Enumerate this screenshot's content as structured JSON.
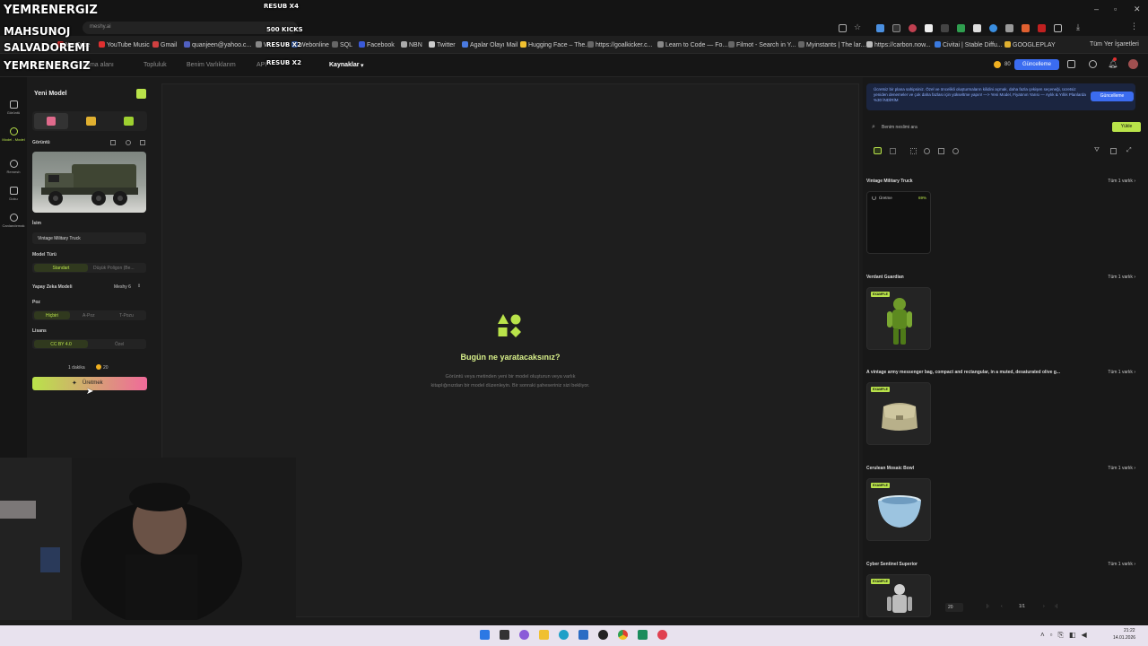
{
  "overlay": {
    "streamer1": "YEMRENERGIZ",
    "streamer2": "MAHSUNOJ",
    "streamer3": "SALVADOREMI",
    "streamer4": "YEMRENERGIZ",
    "resub1": "RESUB X4",
    "kicks": "500 KICKS",
    "resub2": "RESUB X2",
    "resub3": "RESUB X2"
  },
  "browser": {
    "url": "meshy.ai",
    "bookmarks": [
      "YouTube",
      "YouTube Music",
      "Gmail",
      "quanjeen@yahoo.c...",
      "W...",
      "Webonline",
      "SQL",
      "Facebook",
      "NBN",
      "Twitter",
      "Agalar Olayı Mail",
      "Hugging Face – The...",
      "https://goalkicker.c...",
      "Learn to Code — Fo...",
      "Filmot - Search in Y...",
      "Myinstants | The lar...",
      "https://carbon.now...",
      "Civitai | Stable Diffu...",
      "GOOGLEPLAY"
    ],
    "all_bookmarks": "Tüm Yer İşaretleri"
  },
  "appnav": {
    "items": [
      "Çalışma alanı",
      "Topluluk",
      "Benim Varlıklarım",
      "API",
      "Kaynaklar"
    ],
    "credits": "80",
    "upgrade": "Güncelleme"
  },
  "rail": {
    "items": [
      "Görüntü",
      "Model - Model",
      "Remesh",
      "Doku",
      "Canlandırmak"
    ]
  },
  "panel": {
    "title": "Yeni Model",
    "image_label": "Görüntü",
    "name_label": "İsim",
    "name_value": "Vintage Military Truck",
    "model_type_label": "Model Türü",
    "model_type_options": [
      "Standart",
      "Düşük Poligon (Be..."
    ],
    "ai_model_label": "Yapay Zeka Modeli",
    "ai_model_value": "Meshy 6",
    "pose_label": "Poz",
    "pose_options": [
      "Hiçbiri",
      "A-Poz",
      "T-Pozu"
    ],
    "license_label": "Lisans",
    "license_options": [
      "CC BY 4.0",
      "Özel"
    ],
    "duration": "1 dakika",
    "cost": "20",
    "generate": "Üretmek"
  },
  "main": {
    "heading": "Bugün ne yaratacaksınız?",
    "line1": "Görüntü veya metinden yeni bir model oluşturun veya varlık",
    "line2": "kitaplığınızdan bir model düzenleyin. Bir sonraki şaheseriniz sizi bekliyor."
  },
  "right": {
    "promo": "Ücretsiz bir plana sahipsiniz. Özel ve öncelikli oluşturmaların kilidini açmak, daha fazla çekişen seçeneği, ücretsiz yeniden denemeler ve çok daha fazlası için yükseltme yapın! —> Yeni Model, Fiyatının Yarısı — Aylık & Yıllık Planlarda %30 İNDİRİM",
    "promo_button": "Güncelleme",
    "search_placeholder": "Benim neslimi ara",
    "upload": "Yükle",
    "assets": [
      {
        "title": "Vintage Military Truck",
        "count": "Tüm 1 varlık",
        "status": "Üretme",
        "progress": "69%"
      },
      {
        "title": "Verdant Guardian",
        "count": "Tüm 1 varlık",
        "badge": "EXAMPLE"
      },
      {
        "title": "A vintage army messenger bag, compact and rectangular, in a muted, desaturated olive g...",
        "count": "Tüm 1 varlık",
        "badge": "EXAMPLE"
      },
      {
        "title": "Cerulean Mosaic Bowl",
        "count": "Tüm 1 varlık",
        "badge": "EXAMPLE"
      },
      {
        "title": "Cyber Sentinel Superior",
        "count": "Tüm 1 varlık",
        "badge": "EXAMPLE"
      }
    ],
    "page_size": "20",
    "page": "1/1"
  },
  "taskbar": {
    "time": "21:22",
    "date": "14.01.2026"
  },
  "colors": {
    "accent": "#b9e34a",
    "gradient_end": "#f06a9a",
    "upgrade_blue": "#3b6cf0"
  }
}
